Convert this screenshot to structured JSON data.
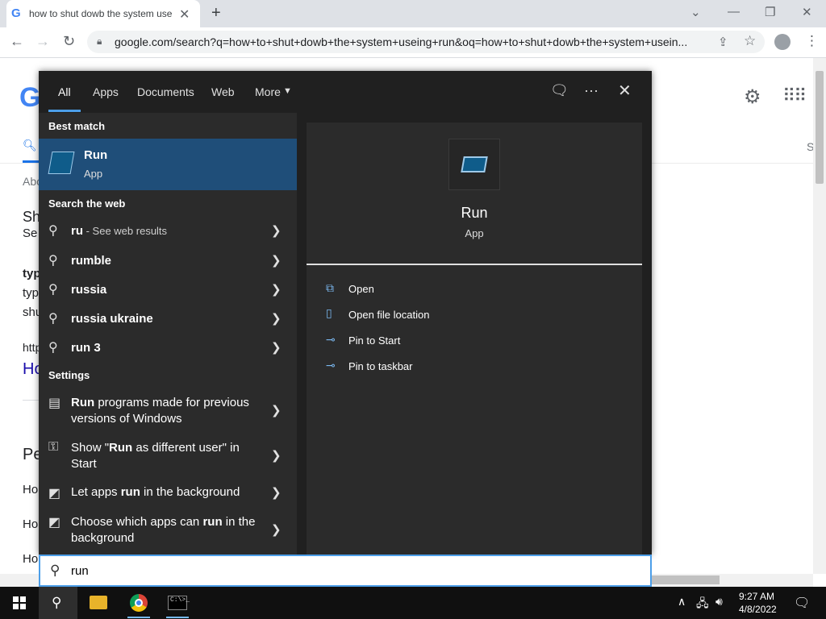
{
  "browser": {
    "tab_title": "how to shut dowb the system use",
    "tab_favicon": "G",
    "url": "google.com/search?q=how+to+shut+dowb+the+system+useing+run&oq=how+to+shut+dowb+the+system+usein..."
  },
  "google_page": {
    "logo": "G",
    "s_right": "S",
    "fragments": [
      "Abo",
      "Sh",
      "Se",
      "typ",
      "typ",
      "shu",
      "http",
      "Ho",
      "Pe",
      "Ho",
      "Ho",
      "Ho"
    ]
  },
  "search_panel": {
    "tabs": [
      "All",
      "Apps",
      "Documents",
      "Web",
      "More"
    ],
    "best_match_label": "Best match",
    "best_match": {
      "title": "Run",
      "subtitle": "App"
    },
    "search_web_label": "Search the web",
    "web_results": [
      {
        "text": "ru",
        "suffix": " - See web results"
      },
      {
        "text": "rumble"
      },
      {
        "text": "russia"
      },
      {
        "text": "russia ukraine"
      },
      {
        "text": "run 3"
      }
    ],
    "settings_label": "Settings",
    "settings_results": [
      {
        "pre": "",
        "bold": "Run",
        "post": " programs made for previous versions of Windows"
      },
      {
        "pre": "Show \"",
        "bold": "Run",
        "post": " as different user\" in Start"
      },
      {
        "pre": "Let apps ",
        "bold": "run",
        "post": " in the background"
      },
      {
        "pre": "Choose which apps can ",
        "bold": "run",
        "post": " in the background"
      }
    ],
    "detail": {
      "title": "Run",
      "subtitle": "App"
    },
    "actions": [
      "Open",
      "Open file location",
      "Pin to Start",
      "Pin to taskbar"
    ],
    "query": "run"
  },
  "taskbar": {
    "time": "9:27 AM",
    "date": "4/8/2022",
    "cmd_label": "C:\\>_"
  },
  "colors": {
    "accent": "#4c9ee8",
    "selected": "#1f4e79",
    "panel": "#202020"
  }
}
